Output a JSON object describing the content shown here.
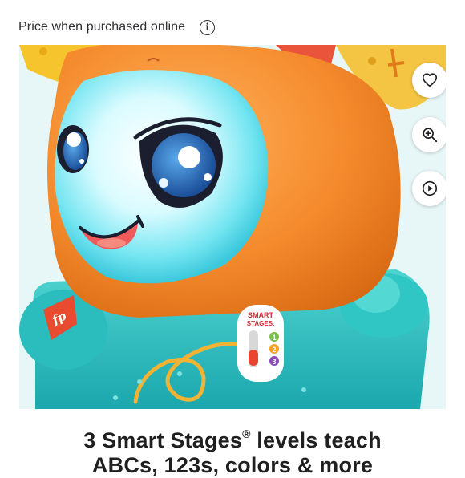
{
  "price_note": {
    "text": "Price when purchased online",
    "info_icon": "info-icon"
  },
  "product_image": {
    "alt": "Fisher-Price Smart Stages toy",
    "badge": {
      "line1": "SMART",
      "line2": "STAGES.",
      "levels": [
        "1",
        "2",
        "3"
      ]
    },
    "brand_mark": "fp"
  },
  "actions": {
    "favorite_icon": "heart-icon",
    "zoom_icon": "zoom-in-icon",
    "video_icon": "play-icon"
  },
  "caption": {
    "line1_pre": "3 Smart Stages",
    "registered": "®",
    "line1_post": " levels teach",
    "line2": "ABCs, 123s, colors & more"
  },
  "colors": {
    "toy_orange": "#f2882a",
    "face_glow": "#6fe6f2",
    "toy_teal": "#2fbfc0",
    "background": "#e7f6f7",
    "yellow_accent": "#f6c52d"
  }
}
